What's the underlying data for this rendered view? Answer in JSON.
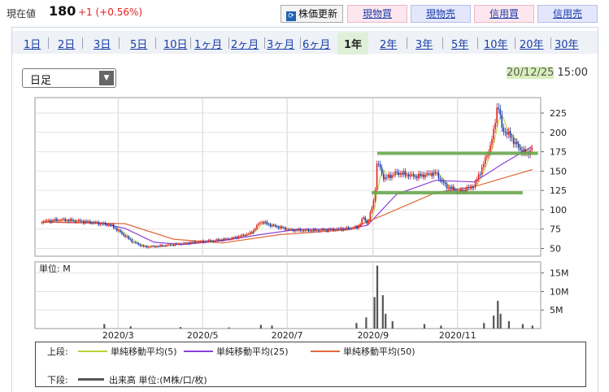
{
  "header": {
    "price_label": "現在値",
    "price_value": "180",
    "price_change": "+1 (+0.56%)",
    "refresh_label": "株価更新",
    "buy_cash_label": "現物買",
    "sell_cash_label": "現物売",
    "buy_margin_label": "信用買",
    "sell_margin_label": "信用売"
  },
  "tabs": [
    {
      "label": "1日"
    },
    {
      "label": "2日"
    },
    {
      "label": "3日"
    },
    {
      "label": "5日"
    },
    {
      "label": "10日"
    },
    {
      "label": "1ヶ月"
    },
    {
      "label": "2ヶ月"
    },
    {
      "label": "3ヶ月"
    },
    {
      "label": "6ヶ月"
    },
    {
      "label": "1年"
    },
    {
      "label": "2年"
    },
    {
      "label": "3年"
    },
    {
      "label": "5年"
    },
    {
      "label": "10年"
    },
    {
      "label": "20年"
    },
    {
      "label": "30年"
    }
  ],
  "active_tab": "1年",
  "period_select": {
    "selected": "日足"
  },
  "datetime": {
    "date": "20/12/25",
    "time": "15:00"
  },
  "legend": {
    "upper_label": "上段:",
    "ma5": "単純移動平均(5)",
    "ma25": "単純移動平均(25)",
    "ma50": "単純移動平均(50)",
    "lower_label": "下段:",
    "volume": "出来高 単位:(M株/口/枚)"
  },
  "colors": {
    "up_candle": "#e02020",
    "down_candle": "#1a3aa8",
    "ma5": "#b6d33a",
    "ma25": "#8d3fd6",
    "ma50": "#e0693a",
    "annotation": "#6aa84f",
    "volume": "#555555"
  },
  "chart_data": [
    {
      "type": "candlestick",
      "x_ticks": [
        "2020/3",
        "2020/5",
        "2020/7",
        "2020/9",
        "2020/11"
      ],
      "y_ticks": [
        50,
        75,
        100,
        125,
        150,
        175,
        200,
        225
      ],
      "ylim": [
        40,
        245
      ],
      "grid": true,
      "price_path": [
        [
          "2020-01-06",
          85
        ],
        [
          "2020-01-20",
          87
        ],
        [
          "2020-02-10",
          84
        ],
        [
          "2020-02-25",
          80
        ],
        [
          "2020-03-06",
          66
        ],
        [
          "2020-03-12",
          58
        ],
        [
          "2020-03-20",
          52
        ],
        [
          "2020-03-31",
          53
        ],
        [
          "2020-04-10",
          55
        ],
        [
          "2020-04-24",
          58
        ],
        [
          "2020-05-08",
          60
        ],
        [
          "2020-05-22",
          63
        ],
        [
          "2020-06-05",
          70
        ],
        [
          "2020-06-12",
          85
        ],
        [
          "2020-06-19",
          80
        ],
        [
          "2020-07-03",
          74
        ],
        [
          "2020-07-17",
          73
        ],
        [
          "2020-07-31",
          74
        ],
        [
          "2020-08-14",
          76
        ],
        [
          "2020-08-21",
          77
        ],
        [
          "2020-08-25",
          90
        ],
        [
          "2020-08-28",
          82
        ],
        [
          "2020-09-02",
          115
        ],
        [
          "2020-09-04",
          163
        ],
        [
          "2020-09-09",
          140
        ],
        [
          "2020-09-18",
          148
        ],
        [
          "2020-10-02",
          143
        ],
        [
          "2020-10-16",
          148
        ],
        [
          "2020-10-23",
          131
        ],
        [
          "2020-11-02",
          123
        ],
        [
          "2020-11-13",
          131
        ],
        [
          "2020-11-20",
          160
        ],
        [
          "2020-11-25",
          185
        ],
        [
          "2020-11-27",
          200
        ],
        [
          "2020-11-30",
          240
        ],
        [
          "2020-12-03",
          205
        ],
        [
          "2020-12-09",
          195
        ],
        [
          "2020-12-15",
          180
        ],
        [
          "2020-12-21",
          172
        ],
        [
          "2020-12-25",
          180
        ]
      ],
      "moving_averages": {
        "ma25": [
          [
            "2020-01-06",
            84
          ],
          [
            "2020-02-17",
            83
          ],
          [
            "2020-03-06",
            76
          ],
          [
            "2020-03-27",
            58
          ],
          [
            "2020-04-17",
            55
          ],
          [
            "2020-05-15",
            60
          ],
          [
            "2020-06-12",
            68
          ],
          [
            "2020-07-10",
            75
          ],
          [
            "2020-08-14",
            75
          ],
          [
            "2020-08-28",
            80
          ],
          [
            "2020-09-18",
            120
          ],
          [
            "2020-10-16",
            138
          ],
          [
            "2020-11-13",
            136
          ],
          [
            "2020-12-04",
            160
          ],
          [
            "2020-12-25",
            182
          ]
        ],
        "ma50": [
          [
            "2020-01-06",
            84
          ],
          [
            "2020-03-06",
            82
          ],
          [
            "2020-04-10",
            62
          ],
          [
            "2020-05-15",
            57
          ],
          [
            "2020-06-26",
            68
          ],
          [
            "2020-08-14",
            74
          ],
          [
            "2020-09-11",
            95
          ],
          [
            "2020-10-16",
            122
          ],
          [
            "2020-11-13",
            130
          ],
          [
            "2020-12-25",
            152
          ]
        ]
      },
      "annotations": [
        {
          "type": "hline",
          "y": 173,
          "from": "2020-09-04",
          "to": "2020-12-29"
        },
        {
          "type": "hline",
          "y": 122,
          "from": "2020-08-31",
          "to": "2020-12-18"
        }
      ]
    },
    {
      "type": "bar",
      "name": "volume",
      "unit_label": "単位: M",
      "y_ticks": [
        "5M",
        "10M",
        "15M"
      ],
      "ylim": [
        0,
        18
      ],
      "values": [
        [
          "2020-02-20",
          1.2
        ],
        [
          "2020-03-10",
          0.6
        ],
        [
          "2020-04-15",
          0.4
        ],
        [
          "2020-05-20",
          0.3
        ],
        [
          "2020-06-12",
          1.0
        ],
        [
          "2020-06-20",
          0.8
        ],
        [
          "2020-08-20",
          1.5
        ],
        [
          "2020-08-27",
          3.0
        ],
        [
          "2020-09-02",
          8.5
        ],
        [
          "2020-09-04",
          17.0
        ],
        [
          "2020-09-08",
          9.0
        ],
        [
          "2020-09-10",
          4.0
        ],
        [
          "2020-09-15",
          2.0
        ],
        [
          "2020-10-08",
          1.2
        ],
        [
          "2020-10-20",
          0.8
        ],
        [
          "2020-11-20",
          1.5
        ],
        [
          "2020-11-27",
          3.5
        ],
        [
          "2020-11-30",
          7.5
        ],
        [
          "2020-12-02",
          4.0
        ],
        [
          "2020-12-08",
          2.0
        ],
        [
          "2020-12-18",
          1.2
        ],
        [
          "2020-12-25",
          0.8
        ]
      ]
    }
  ]
}
